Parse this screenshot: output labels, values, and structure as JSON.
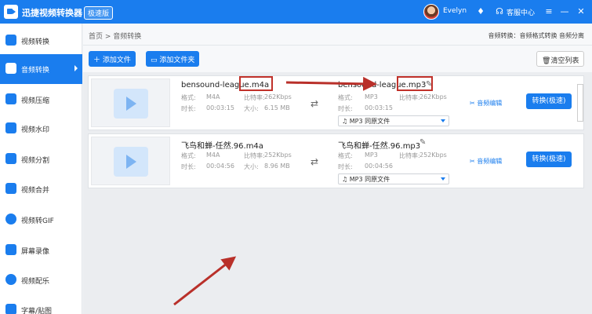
{
  "titlebar": {
    "app_title": "迅捷视频转换器",
    "edition": "极速版",
    "username": "Evelyn",
    "service": "客服中心",
    "icons": [
      "avatar",
      "vip-icon",
      "headset-icon",
      "menu-icon",
      "minimize-icon",
      "close-icon"
    ]
  },
  "sidebar": {
    "items": [
      {
        "label": "视频转换",
        "icon": "video-convert-icon"
      },
      {
        "label": "音频转换",
        "icon": "audio-convert-icon",
        "active": true
      },
      {
        "label": "视频压缩",
        "icon": "compress-icon"
      },
      {
        "label": "视频水印",
        "icon": "watermark-icon"
      },
      {
        "label": "视频分割",
        "icon": "split-icon"
      },
      {
        "label": "视频合并",
        "icon": "merge-icon"
      },
      {
        "label": "视频转GIF",
        "icon": "gif-icon"
      },
      {
        "label": "屏幕录像",
        "icon": "record-icon"
      },
      {
        "label": "视频配乐",
        "icon": "music-icon"
      },
      {
        "label": "字幕/贴图",
        "icon": "subtitle-icon"
      }
    ]
  },
  "breadcrumb": {
    "home": "首页",
    "current": "音频转换"
  },
  "format_note": "音频转换：音频格式转换 音频分离",
  "toolbar": {
    "add_file": "添加文件",
    "add_folder": "添加文件夹",
    "clear_list": "清空列表"
  },
  "accent": "#1a7dee",
  "files": [
    {
      "source_name": "bensound-league.m4a",
      "format_label": "格式:",
      "format": "M4A",
      "bitrate_label": "比特率:",
      "bitrate": "262Kbps",
      "duration_label": "时长:",
      "duration": "00:03:15",
      "size_label": "大小:",
      "size": "6.15 MB",
      "output_name": "bensound-league.mp3",
      "out_format": "MP3",
      "out_bitrate": "262Kbps",
      "out_duration": "00:03:15",
      "select_value": "MP3   同原文件",
      "edit_label": "音频编辑",
      "convert_label": "转换(极速)"
    },
    {
      "source_name": "飞鸟和蝉-任然.96.m4a",
      "format_label": "格式:",
      "format": "M4A",
      "bitrate_label": "比特率:",
      "bitrate": "252Kbps",
      "duration_label": "时长:",
      "duration": "00:04:56",
      "size_label": "大小:",
      "size": "8.96 MB",
      "output_name": "飞鸟和蝉-任然.96.mp3",
      "out_format": "MP3",
      "out_bitrate": "252Kbps",
      "out_duration": "00:04:56",
      "select_value": "MP3   同原文件",
      "edit_label": "音频编辑",
      "convert_label": "转换(极速)"
    }
  ]
}
